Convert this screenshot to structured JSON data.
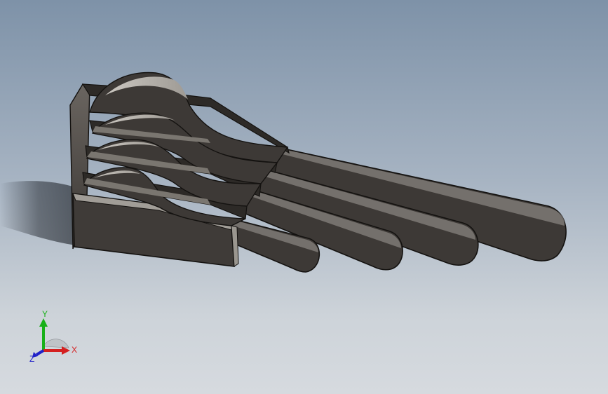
{
  "viewport": {
    "background_top": "#7e92a8",
    "background_bottom": "#d6dadf",
    "model_color": "#3d3936",
    "model_highlight": "#b8b4ae",
    "model_edge": "#141210"
  },
  "triad": {
    "x_label": "X",
    "y_label": "Y",
    "z_label": "Z",
    "x_color": "#d42020",
    "y_color": "#18b018",
    "z_color": "#2020c8"
  }
}
